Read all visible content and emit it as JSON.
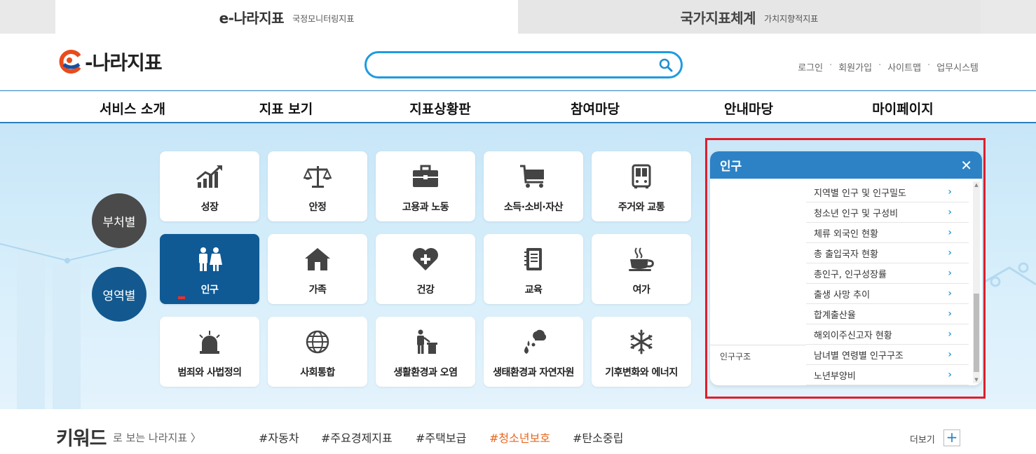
{
  "site_tabs": [
    {
      "main": "e-나라지표",
      "sub": "국정모니터링지표"
    },
    {
      "main": "국가지표체계",
      "sub": "가치지향적지표"
    }
  ],
  "header": {
    "logo_text": "-나라지표",
    "search": {
      "placeholder": "",
      "value": ""
    },
    "util_links": [
      "로그인",
      "회원가입",
      "사이트맵",
      "업무시스템"
    ]
  },
  "nav": [
    "서비스 소개",
    "지표 보기",
    "지표상황판",
    "참여마당",
    "안내마당",
    "마이페이지"
  ],
  "side_buttons": {
    "by_ministry": "부처별",
    "by_area": "영역별"
  },
  "tiles": [
    {
      "label": "성장",
      "icon": "growth-chart-icon"
    },
    {
      "label": "안정",
      "icon": "scale-icon"
    },
    {
      "label": "고용과 노동",
      "icon": "briefcase-icon"
    },
    {
      "label": "소득·소비·자산",
      "icon": "cart-icon"
    },
    {
      "label": "주거와 교통",
      "icon": "bus-icon"
    },
    {
      "label": "인구",
      "icon": "people-icon"
    },
    {
      "label": "가족",
      "icon": "house-icon"
    },
    {
      "label": "건강",
      "icon": "heart-plus-icon"
    },
    {
      "label": "교육",
      "icon": "notebook-icon"
    },
    {
      "label": "여가",
      "icon": "coffee-icon"
    },
    {
      "label": "범죄와 사법정의",
      "icon": "siren-icon"
    },
    {
      "label": "사회통합",
      "icon": "globe-icon"
    },
    {
      "label": "생활환경과 오염",
      "icon": "trash-person-icon"
    },
    {
      "label": "생태환경과 자연자원",
      "icon": "cloud-rain-icon"
    },
    {
      "label": "기후변화와 에너지",
      "icon": "snowflake-icon"
    }
  ],
  "popup": {
    "title": "인구",
    "close": "✕",
    "items": [
      "지역별 인구 및 인구밀도",
      "청소년 인구 및 구성비",
      "체류 외국인 현황",
      "총 출입국자 현황",
      "총인구, 인구성장률",
      "출생 사망 추이",
      "합계출산율",
      "해외이주신고자 현황",
      "남녀별 연령별 인구구조",
      "노년부양비"
    ],
    "category": "인구구조"
  },
  "keywords": {
    "title": "키워드",
    "sub": "로 보는 나라지표 〉",
    "tags": [
      "#자동차",
      "#주요경제지표",
      "#주택보급",
      "#청소년보호",
      "#탄소중립"
    ],
    "highlight_color": "#e8671c",
    "more": "더보기"
  },
  "colors": {
    "accent": "#2d82c5",
    "active_tile": "#0f5a95",
    "highlight_box": "#e01e2c"
  }
}
